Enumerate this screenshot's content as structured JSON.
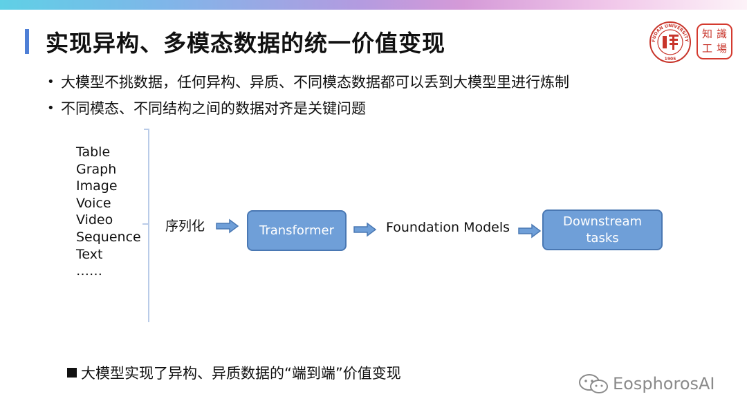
{
  "header": {
    "title": "实现异构、多模态数据的统一价值变现"
  },
  "logos": {
    "university_text": "FUDAN UNIVERSITY",
    "university_year": "1905",
    "right_chars": [
      "知",
      "識",
      "工",
      "場"
    ]
  },
  "bullets": [
    "大模型不挑数据，任何异构、异质、不同模态数据都可以丢到大模型里进行炼制",
    "不同模态、不同结构之间的数据对齐是关键问题"
  ],
  "diagram": {
    "data_types": [
      "Table",
      "Graph",
      "Image",
      "Voice",
      "Video",
      "Sequence",
      "Text",
      "……"
    ],
    "serialize_label": "序列化",
    "transformer_label": "Transformer",
    "foundation_label": "Foundation Models",
    "downstream_line1": "Downstream",
    "downstream_line2": "tasks"
  },
  "summary": "大模型实现了异构、异质数据的“端到端”价值变现",
  "watermark": "EosphorosAI",
  "colors": {
    "accent_bar": "#4e7fd6",
    "box_fill": "#6f9fd8",
    "box_border": "#4a78b3",
    "logo_red": "#c8352b"
  }
}
